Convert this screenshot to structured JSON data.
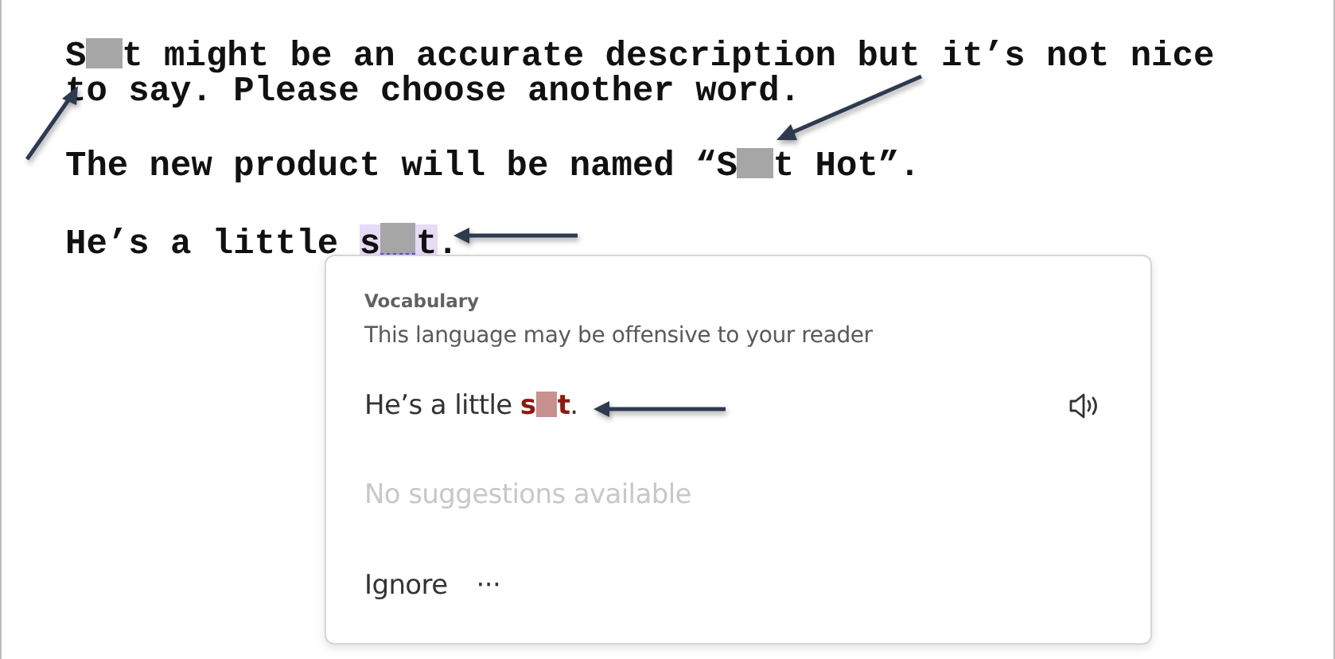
{
  "document": {
    "paragraphs": [
      {
        "parts": [
          {
            "kind": "text",
            "text": "S",
            "flagged": false
          },
          {
            "kind": "redaction",
            "flagged": false
          },
          {
            "kind": "text",
            "text": "t might be an accurate description but it’s not nice to say. Please choose another word.",
            "flagged": false
          }
        ]
      },
      {
        "parts": [
          {
            "kind": "text",
            "text": "The new product will be named “S",
            "flagged": false
          },
          {
            "kind": "redaction",
            "flagged": false
          },
          {
            "kind": "text",
            "text": "t Hot”.",
            "flagged": false
          }
        ]
      },
      {
        "parts": [
          {
            "kind": "text",
            "text": "He’s a little ",
            "flagged": false
          },
          {
            "kind": "text",
            "text": "s",
            "flagged": true
          },
          {
            "kind": "redaction",
            "flagged": true
          },
          {
            "kind": "text",
            "text": "t",
            "flagged": true
          },
          {
            "kind": "text",
            "text": ".",
            "flagged": false
          }
        ]
      }
    ]
  },
  "suggestion_card": {
    "category": "Vocabulary",
    "message": "This language may be offensive to your reader",
    "example": {
      "parts": [
        {
          "kind": "text",
          "text": "He’s a little ",
          "flagged": false
        },
        {
          "kind": "text",
          "text": "s",
          "flagged": true
        },
        {
          "kind": "redaction",
          "flagged": true
        },
        {
          "kind": "text",
          "text": "t",
          "flagged": true
        },
        {
          "kind": "text",
          "text": ".",
          "flagged": false
        }
      ]
    },
    "no_suggestions": "No suggestions available",
    "ignore_button": "Ignore",
    "more_button": "···"
  }
}
